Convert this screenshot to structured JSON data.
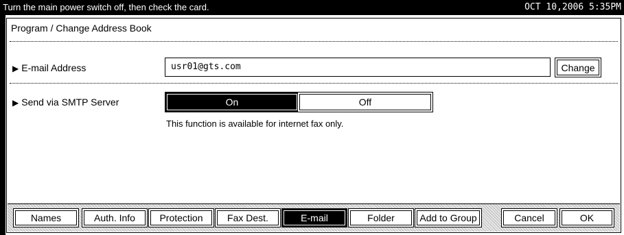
{
  "status_bar": {
    "message": "Turn the main power switch off, then check the card.",
    "datetime": "OCT  10,2006  5:35PM"
  },
  "panel": {
    "title": "Program / Change Address Book"
  },
  "email_row": {
    "label": "E-mail Address",
    "value": "usr01@gts.com",
    "change_label": "Change"
  },
  "smtp_row": {
    "label": "Send via SMTP Server",
    "on_label": "On",
    "off_label": "Off",
    "selected": "On",
    "note": "This function is available for internet fax only."
  },
  "tabs": [
    {
      "label": "Names"
    },
    {
      "label": "Auth. Info"
    },
    {
      "label": "Protection"
    },
    {
      "label": "Fax Dest."
    },
    {
      "label": "E-mail"
    },
    {
      "label": "Folder"
    },
    {
      "label": "Add to Group"
    }
  ],
  "active_tab": "E-mail",
  "actions": {
    "cancel_label": "Cancel",
    "ok_label": "OK"
  }
}
